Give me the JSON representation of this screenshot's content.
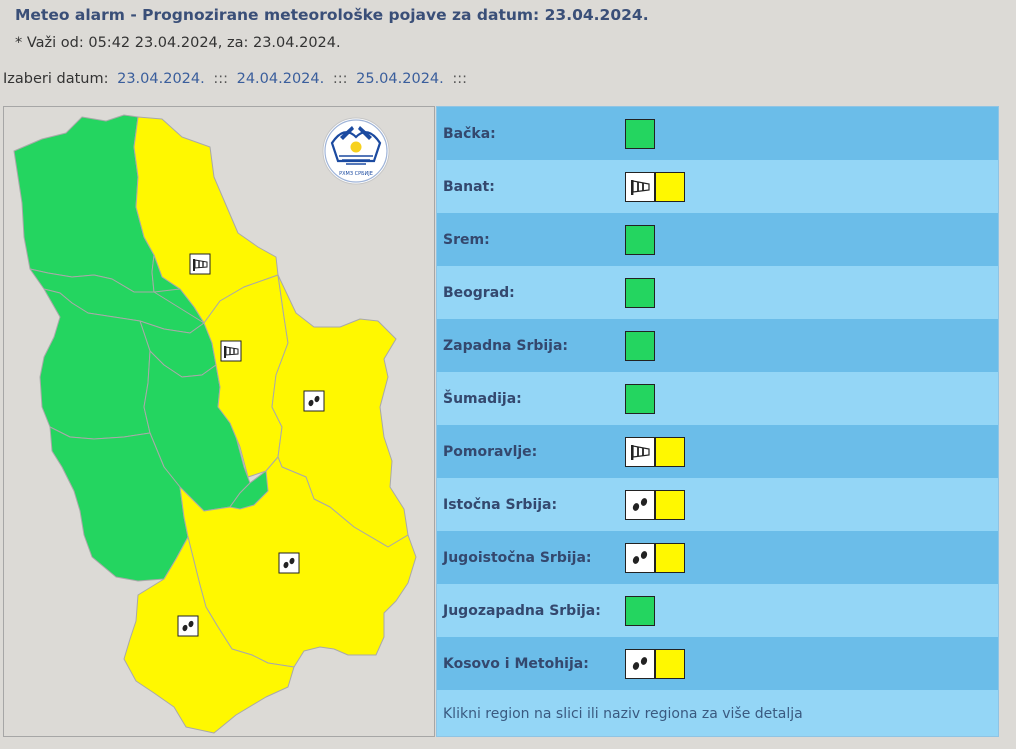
{
  "header": {
    "title": "Meteo alarm - Prognozirane meteorološke pojave za datum:  23.04.2024.",
    "validity": "* Važi od: 05:42 23.04.2024, za: 23.04.2024."
  },
  "date_selector": {
    "label": "Izaberi datum:",
    "dates": [
      "23.04.2024.",
      "24.04.2024.",
      "25.04.2024."
    ],
    "separator": ":::"
  },
  "colors": {
    "green": "#24d560",
    "yellow": "#fff800",
    "row_dark": "#6bbde9",
    "row_light": "#94d6f6",
    "title": "#3a4f78"
  },
  "map": {
    "logo_text": "РХМЗ СРБИЈЕ"
  },
  "regions": [
    {
      "name": "Bačka:",
      "level": "green",
      "icon": null
    },
    {
      "name": "Banat:",
      "level": "yellow",
      "icon": "wind-icon"
    },
    {
      "name": "Srem:",
      "level": "green",
      "icon": null
    },
    {
      "name": "Beograd:",
      "level": "green",
      "icon": null
    },
    {
      "name": "Zapadna Srbija:",
      "level": "green",
      "icon": null
    },
    {
      "name": "Šumadija:",
      "level": "green",
      "icon": null
    },
    {
      "name": "Pomoravlje:",
      "level": "yellow",
      "icon": "wind-icon"
    },
    {
      "name": "Istočna Srbija:",
      "level": "yellow",
      "icon": "rain-icon"
    },
    {
      "name": "Jugoistočna Srbija:",
      "level": "yellow",
      "icon": "rain-icon"
    },
    {
      "name": "Jugozapadna Srbija:",
      "level": "green",
      "icon": null
    },
    {
      "name": "Kosovo i Metohija:",
      "level": "yellow",
      "icon": "rain-icon"
    }
  ],
  "footer": {
    "hint": "Klikni region na slici ili naziv regiona za više detalja"
  }
}
